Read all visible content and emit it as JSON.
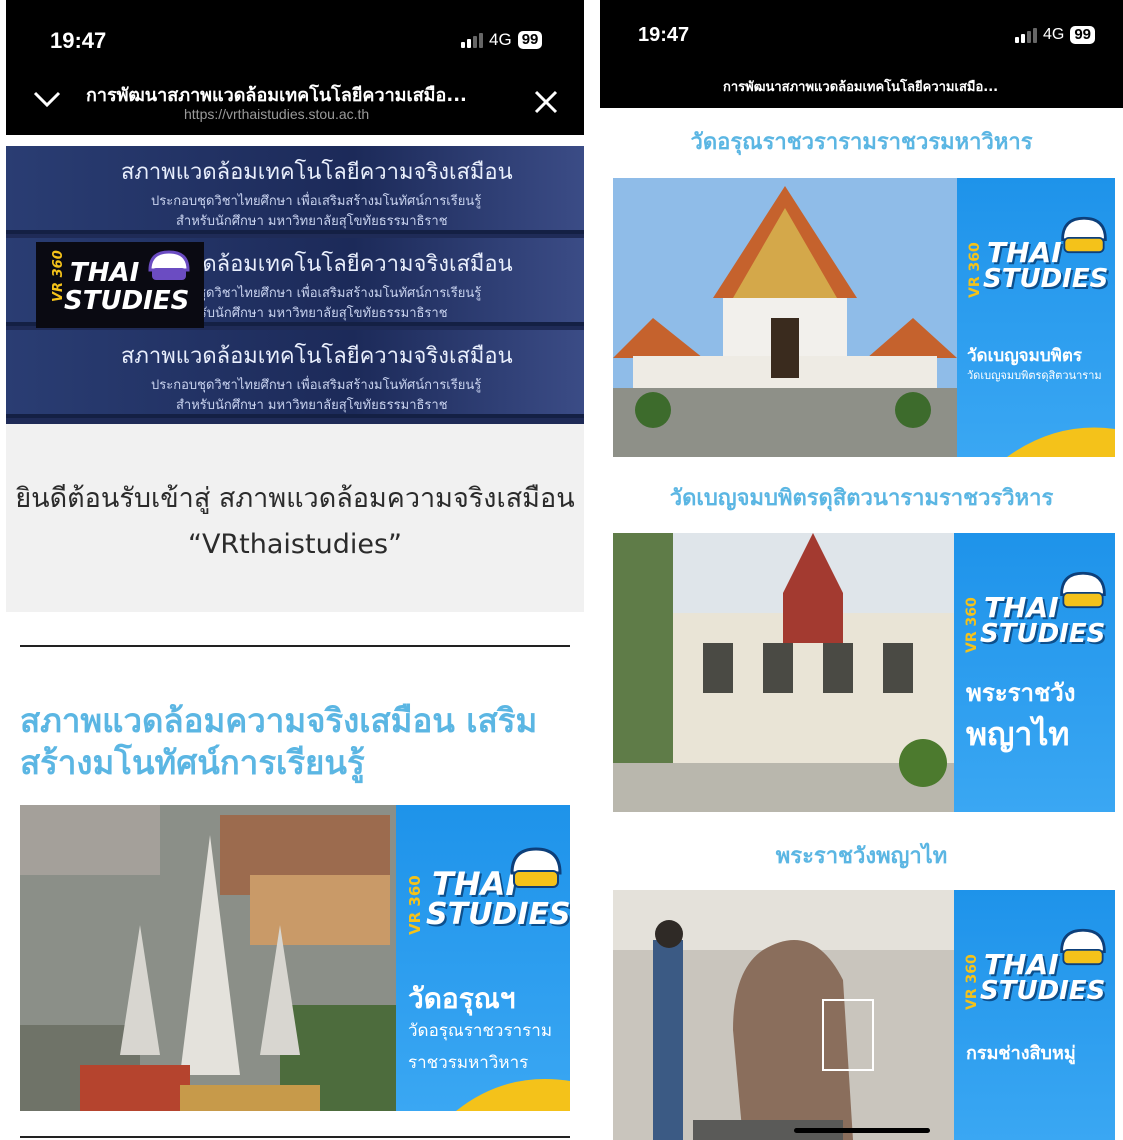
{
  "left": {
    "status": {
      "time": "19:47",
      "network": "4G",
      "battery": "99"
    },
    "nav": {
      "title": "การพัฒนาสภาพแวดล้อมเทคโนโลยีความเสมือ...",
      "url": "https://vrthaistudies.stou.ac.th",
      "collapse_icon": "chevron-down-icon",
      "close_icon": "close-icon"
    },
    "banner": {
      "heading": "สภาพแวดล้อมเทคโนโลยีความจริงเสมือน",
      "line1": "ประกอบชุดวิชาไทยศึกษา เพื่อเสริมสร้างมโนทัศน์การเรียนรู้",
      "line2": "สำหรับนักศึกษา มหาวิทยาลัยสุโขทัยธรรมาธิราช"
    },
    "welcome": "ยินดีต้อนรับเข้าสู่ สภาพแวดล้อมความจริงเสมือน “VRthaistudies”",
    "heading": "สภาพแวดล้อมความจริงเสมือน เสริมสร้างมโนทัศน์การเรียนรู้",
    "card": {
      "vr": "VR 360",
      "thai": "THAI",
      "studies": "STUDIES",
      "place": "วัดอรุณฯ",
      "sub1": "วัดอรุณราชวราราม",
      "sub2": "ราชวรมหาวิหาร"
    }
  },
  "right": {
    "status": {
      "time": "19:47",
      "network": "4G",
      "battery": "99"
    },
    "nav": {
      "title": "การพัฒนาสภาพแวดล้อมเทคโนโลยีความเสมือ..."
    },
    "sections": [
      {
        "title": "วัดอรุณราชวรารามราชวรมหาวิหาร",
        "card": {
          "vr": "VR 360",
          "thai": "THAI",
          "studies": "STUDIES",
          "place": "วัดเบญจมบพิตร",
          "sub": "วัดเบญจมบพิตรดุสิตวนาราม"
        }
      },
      {
        "title": "วัดเบญจมบพิตรดุสิตวนารามราชวรวิหาร",
        "card": {
          "vr": "VR 360",
          "thai": "THAI",
          "studies": "STUDIES",
          "place1": "พระราชวัง",
          "place2": "พญาไท"
        }
      },
      {
        "title": "พระราชวังพญาไท",
        "card": {
          "vr": "VR 360",
          "thai": "THAI",
          "studies": "STUDIES",
          "place": "กรมช่างสิบหมู่"
        }
      }
    ]
  },
  "colors": {
    "accent": "#5bb6e3",
    "panel_blue": "#2a9be8",
    "logo_yellow": "#f4c21a"
  }
}
